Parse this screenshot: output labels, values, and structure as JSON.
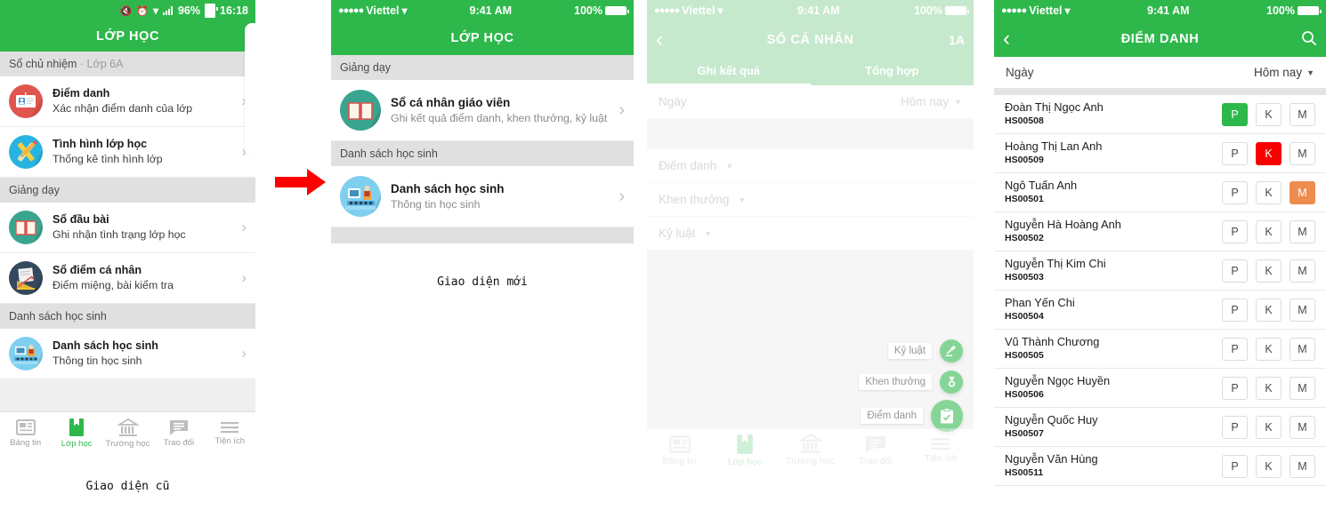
{
  "colors": {
    "green": "#2eb84b",
    "green_faded": "#9dd9aa",
    "present_green": "#2eb84b",
    "absent_red": "#f90000",
    "late_orange": "#ee8b4f",
    "arrow_red": "#ff0000",
    "section_gray": "#e0e0e0"
  },
  "captions": {
    "old_ui": "Giao diện cũ",
    "new_ui": "Giao diện mới"
  },
  "phone1": {
    "status": {
      "battery": "96%",
      "time": "16:18",
      "icons": [
        "mute-icon",
        "alarm-icon",
        "wifi-icon",
        "signal-icon",
        "battery-icon"
      ]
    },
    "nav": {
      "title": "LỚP HỌC"
    },
    "sections": [
      {
        "label": "Sổ chủ nhiệm",
        "sub": "· Lớp 6A"
      },
      {
        "label": "Giảng dạy",
        "sub": ""
      },
      {
        "label": "Danh sách học sinh",
        "sub": ""
      }
    ],
    "items": [
      {
        "title": "Điểm danh",
        "subtitle": "Xác nhận điểm danh của lớp",
        "icon": "id-card-icon"
      },
      {
        "title": "Tình hình lớp học",
        "subtitle": "Thống kê tình hình lớp",
        "icon": "ruler-pencil-icon"
      },
      {
        "title": "Sổ đầu bài",
        "subtitle": "Ghi nhận tình trạng lớp học",
        "icon": "open-book-icon"
      },
      {
        "title": "Sổ điểm cá nhân",
        "subtitle": "Điểm miệng, bài kiểm tra",
        "icon": "grade-chart-icon"
      },
      {
        "title": "Danh sách học sinh",
        "subtitle": "Thông tin học sinh",
        "icon": "classroom-icon"
      }
    ],
    "tabs": [
      {
        "label": "Bảng tin",
        "icon": "news-icon",
        "active": false
      },
      {
        "label": "Lớp học",
        "icon": "bookmark-icon",
        "active": true
      },
      {
        "label": "Trường học",
        "icon": "bank-icon",
        "active": false
      },
      {
        "label": "Trao đổi",
        "icon": "chat-icon",
        "active": false
      },
      {
        "label": "Tiện ích",
        "icon": "menu-icon",
        "active": false
      }
    ]
  },
  "phone2": {
    "status": {
      "carrier": "Viettel",
      "time": "9:41 AM",
      "battery": "100%",
      "icons": [
        "signal-dots-icon",
        "wifi-icon",
        "battery-icon"
      ]
    },
    "nav": {
      "title": "LỚP  HỌC"
    },
    "sections": [
      {
        "label": "Giảng dạy"
      },
      {
        "label": "Danh sách học sinh"
      }
    ],
    "items": [
      {
        "title": "Sổ cá nhân giáo viên",
        "subtitle": "Ghi kết quả điểm danh, khen thưởng, kỷ luật",
        "icon": "open-book-icon"
      },
      {
        "title": "Danh sách học sinh",
        "subtitle": "Thông tin học sinh",
        "icon": "classroom-icon"
      }
    ]
  },
  "phone3": {
    "status": {
      "carrier": "Viettel",
      "time": "9:41 AM",
      "battery": "100%"
    },
    "nav": {
      "back": "‹",
      "title": "SỔ CÁ NHÂN",
      "right": "1A"
    },
    "tabs": [
      {
        "label": "Ghi kết quả",
        "active": true
      },
      {
        "label": "Tổng hợp",
        "active": false
      }
    ],
    "date_row": {
      "label": "Ngày",
      "value": "Hôm nay"
    },
    "filters": [
      {
        "label": "Điểm danh"
      },
      {
        "label": "Khen thưởng"
      },
      {
        "label": "Kỷ luật"
      }
    ],
    "fabs": [
      {
        "label": "Kỷ luật",
        "icon": "gavel-icon",
        "size": "sm"
      },
      {
        "label": "Khen thưởng",
        "icon": "medal-icon",
        "size": "sm"
      },
      {
        "label": "Điểm danh",
        "icon": "clipboard-check-icon",
        "size": "lg"
      }
    ],
    "tabbar": [
      {
        "label": "Bảng tin",
        "icon": "news-icon",
        "active": false
      },
      {
        "label": "Lớp học",
        "icon": "bookmark-icon",
        "active": true
      },
      {
        "label": "Trường học",
        "icon": "bank-icon",
        "active": false
      },
      {
        "label": "Trao đổi",
        "icon": "chat-icon",
        "active": false
      },
      {
        "label": "Tiện ích",
        "icon": "menu-icon",
        "active": false
      }
    ]
  },
  "phone4": {
    "status": {
      "carrier": "Viettel",
      "time": "9:41 AM",
      "battery": "100%"
    },
    "nav": {
      "back": "‹",
      "title": "ĐIỂM DANH",
      "search_icon": "search-icon"
    },
    "date_row": {
      "label": "Ngày",
      "value": "Hôm nay"
    },
    "mark_labels": [
      "P",
      "K",
      "M"
    ],
    "students": [
      {
        "name": "Đoàn Thị Ngọc Anh",
        "id": "HS00508",
        "selected": "P"
      },
      {
        "name": "Hoàng Thị Lan Anh",
        "id": "HS00509",
        "selected": "K"
      },
      {
        "name": "Ngô Tuấn Anh",
        "id": "HS00501",
        "selected": "M"
      },
      {
        "name": "Nguyễn Hà Hoàng Anh",
        "id": "HS00502",
        "selected": ""
      },
      {
        "name": "Nguyễn Thị Kim Chi",
        "id": "HS00503",
        "selected": ""
      },
      {
        "name": "Phan Yến Chi",
        "id": "HS00504",
        "selected": ""
      },
      {
        "name": "Vũ Thành Chương",
        "id": "HS00505",
        "selected": ""
      },
      {
        "name": "Nguyễn Ngọc Huyền",
        "id": "HS00506",
        "selected": ""
      },
      {
        "name": "Nguyễn Quốc Huy",
        "id": "HS00507",
        "selected": ""
      },
      {
        "name": "Nguyễn Văn Hùng",
        "id": "HS00511",
        "selected": ""
      }
    ]
  }
}
